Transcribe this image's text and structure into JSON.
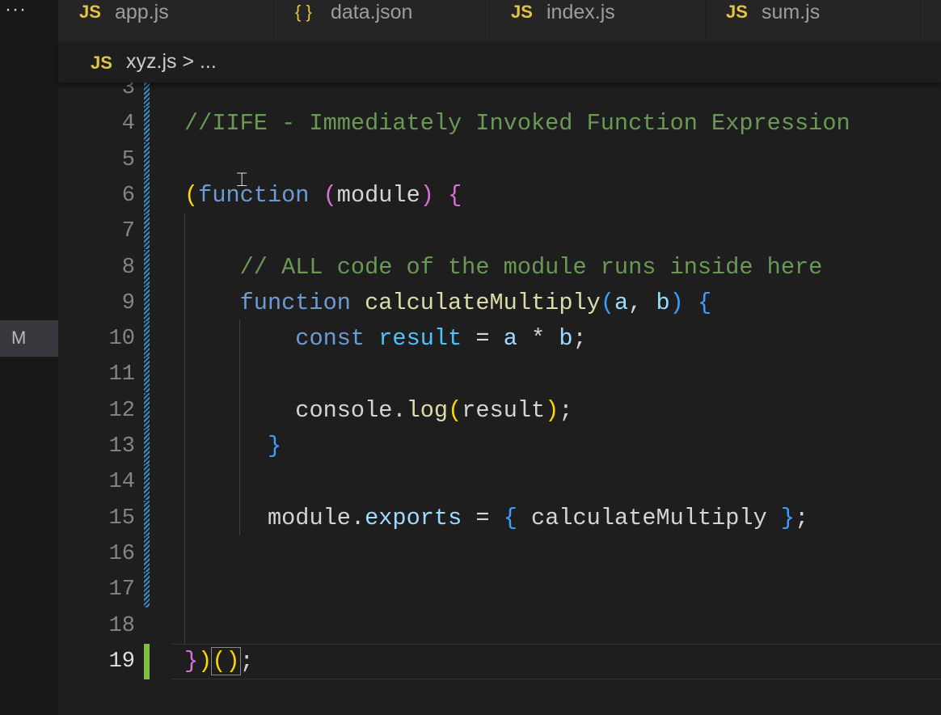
{
  "activity_bar": {
    "more_label": "···",
    "scm_badge": "M"
  },
  "tabs": [
    {
      "icon": "JS",
      "label": "app.js"
    },
    {
      "icon": "{ }",
      "label": "data.json"
    },
    {
      "icon": "JS",
      "label": "index.js"
    },
    {
      "icon": "JS",
      "label": "sum.js"
    }
  ],
  "breadcrumb": {
    "icon": "JS",
    "label": "xyz.js > ..."
  },
  "current_line": 19,
  "lines": [
    {
      "n": "3",
      "tokens": []
    },
    {
      "n": "4",
      "tokens": [
        [
          "//IIFE - Immediately Invoked Function Expression",
          "com"
        ]
      ]
    },
    {
      "n": "5",
      "tokens": []
    },
    {
      "n": "6",
      "tokens": [
        [
          "(",
          "y"
        ],
        [
          "function",
          "kw"
        ],
        [
          " ",
          "w"
        ],
        [
          "(",
          "p"
        ],
        [
          "module",
          "w"
        ],
        [
          ")",
          "p"
        ],
        [
          " ",
          "w"
        ],
        [
          "{",
          "p"
        ]
      ]
    },
    {
      "n": "7",
      "tokens": []
    },
    {
      "n": "8",
      "tokens": [
        [
          "    ",
          "w"
        ],
        [
          "// ALL code of the module runs inside here",
          "com"
        ]
      ]
    },
    {
      "n": "9",
      "tokens": [
        [
          "    ",
          "w"
        ],
        [
          "function",
          "kw"
        ],
        [
          " ",
          "w"
        ],
        [
          "calculateMultiply",
          "fn"
        ],
        [
          "(",
          "b"
        ],
        [
          "a",
          "var"
        ],
        [
          ", ",
          "w"
        ],
        [
          "b",
          "var"
        ],
        [
          ")",
          "b"
        ],
        [
          " ",
          "w"
        ],
        [
          "{",
          "b"
        ]
      ]
    },
    {
      "n": "10",
      "tokens": [
        [
          "        ",
          "w"
        ],
        [
          "const",
          "kw"
        ],
        [
          " ",
          "w"
        ],
        [
          "result",
          "var2"
        ],
        [
          " = ",
          "w"
        ],
        [
          "a",
          "var"
        ],
        [
          " * ",
          "w"
        ],
        [
          "b",
          "var"
        ],
        [
          ";",
          "w"
        ]
      ]
    },
    {
      "n": "11",
      "tokens": []
    },
    {
      "n": "12",
      "tokens": [
        [
          "        ",
          "w"
        ],
        [
          "console",
          "w"
        ],
        [
          ".",
          "w"
        ],
        [
          "log",
          "fn"
        ],
        [
          "(",
          "y"
        ],
        [
          "result",
          "w"
        ],
        [
          ")",
          "y"
        ],
        [
          ";",
          "w"
        ]
      ]
    },
    {
      "n": "13",
      "tokens": [
        [
          "      ",
          "w"
        ],
        [
          "}",
          "b"
        ]
      ]
    },
    {
      "n": "14",
      "tokens": []
    },
    {
      "n": "15",
      "tokens": [
        [
          "      ",
          "w"
        ],
        [
          "module",
          "w"
        ],
        [
          ".",
          "w"
        ],
        [
          "exports",
          "var"
        ],
        [
          " = ",
          "w"
        ],
        [
          "{",
          "b"
        ],
        [
          " calculateMultiply ",
          "w"
        ],
        [
          "}",
          "b"
        ],
        [
          ";",
          "w"
        ]
      ]
    },
    {
      "n": "16",
      "tokens": []
    },
    {
      "n": "17",
      "tokens": []
    },
    {
      "n": "18",
      "tokens": []
    },
    {
      "n": "19",
      "tokens": [
        [
          "}",
          "p"
        ],
        [
          ")",
          "y"
        ],
        [
          "()",
          "y box"
        ],
        [
          ";",
          "w"
        ]
      ]
    }
  ]
}
